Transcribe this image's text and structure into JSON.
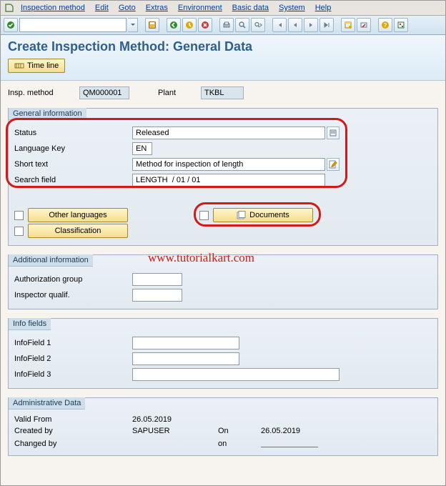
{
  "menu": {
    "items": [
      "Inspection method",
      "Edit",
      "Goto",
      "Extras",
      "Environment",
      "Basic data",
      "System",
      "Help"
    ]
  },
  "page": {
    "title": "Create Inspection Method: General Data",
    "timeline_label": "Time line"
  },
  "header": {
    "insp_method_label": "Insp. method",
    "insp_method_value": "QM000001",
    "plant_label": "Plant",
    "plant_value": "TKBL"
  },
  "general": {
    "title": "General information",
    "rows": {
      "status_label": "Status",
      "status_value": "Released",
      "lang_label": "Language Key",
      "lang_value": "EN",
      "shorttext_label": "Short text",
      "shorttext_value": "Method for inspection of length",
      "search_label": "Search field",
      "search_value": "LENGTH  / 01 / 01"
    },
    "other_languages": "Other languages",
    "classification": "Classification",
    "documents": "Documents"
  },
  "additional": {
    "title": "Additional information",
    "auth_label": "Authorization group",
    "inspector_label": "Inspector qualif."
  },
  "info": {
    "title": "Info fields",
    "f1": "InfoField 1",
    "f2": "InfoField 2",
    "f3": "InfoField 3"
  },
  "admin": {
    "title": "Administrative Data",
    "valid_from_label": "Valid From",
    "valid_from_value": "26.05.2019",
    "created_by_label": "Created by",
    "created_by_value": "SAPUSER",
    "on_label": "On",
    "created_on_value": "26.05.2019",
    "changed_by_label": "Changed by",
    "changed_on_label": "on"
  },
  "watermark": "www.tutorialkart.com"
}
